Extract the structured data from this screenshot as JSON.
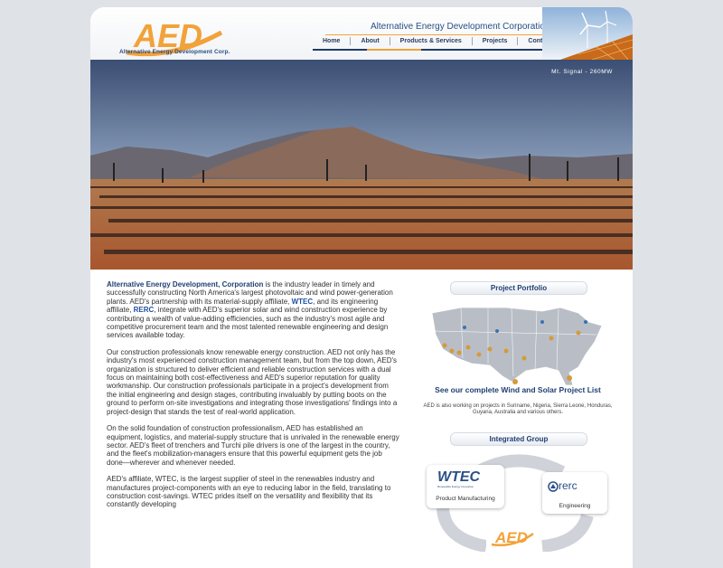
{
  "header": {
    "logo_text": "Alternative Energy Development Corp.",
    "corp_name": "Alternative Energy Development Corporation",
    "nav": [
      "Home",
      "About",
      "Products & Services",
      "Projects",
      "Contact"
    ]
  },
  "hero": {
    "caption": "Mt. Signal - 260MW"
  },
  "content": {
    "p1_lead": "Alternative Energy Development, Corporation",
    "p1_a": " is the industry leader in timely and successfully constructing North America's largest photovoltaic and wind power-generation plants. AED's partnership with its material-supply affiliate, ",
    "p1_wtec": "WTEC",
    "p1_b": ", and its engineering affiliate, ",
    "p1_rerc": "RERC",
    "p1_c": ", integrate with AED's superior solar and wind construction experience by contributing a wealth of value-adding efficiencies, such as the industry's most agile and competitive procurement team and the most talented renewable engineering and design services available today.",
    "p2": "Our construction professionals know renewable energy construction. AED not only has the industry's most experienced construction management team, but from the top down, AED's organization is structured to deliver efficient and reliable construction services with a dual focus on maintaining both cost-effectiveness and AED's superior reputation for quality workmanship. Our construction professionals participate in a project's development from the initial engineering and design stages, contributing invaluably by putting boots on the ground to perform on-site investigations and integrating those investigations' findings into a project-design that stands the test of real-world application.",
    "p3": "On the solid foundation of construction professionalism, AED has established an equipment, logistics, and material-supply structure that is unrivaled in the renewable energy sector. AED's fleet of trenchers and Turchi pile drivers is one of the largest in the country, and the fleet's mobilization-managers ensure that this powerful equipment gets the job done—wherever and whenever needed.",
    "p4": "AED's affiliate, WTEC, is the largest supplier of steel in the renewables industry and manufactures project-components with an eye to reducing labor in the field, translating to construction cost-savings. WTEC prides itself on the versatility and flexibility that its constantly developing"
  },
  "sidebar": {
    "portfolio_title": "Project Portfolio",
    "project_list_link": "See our complete Wind and Solar Project List",
    "project_note": "AED is also working on projects in Suriname, Nigeria, Sierra Leone, Honduras, Guyana, Australia and various others.",
    "group_title": "Integrated Group",
    "wtec_logo": "WTEC",
    "wtec_tagline": "Renewable Energy Innovation",
    "wtec_label": "Product Manufacturing",
    "rerc_logo": "rerc",
    "rerc_label": "Engineering"
  },
  "colors": {
    "brand_orange": "#f2a23a",
    "brand_blue": "#1f3f73",
    "page_bg": "#dfe3e8"
  }
}
